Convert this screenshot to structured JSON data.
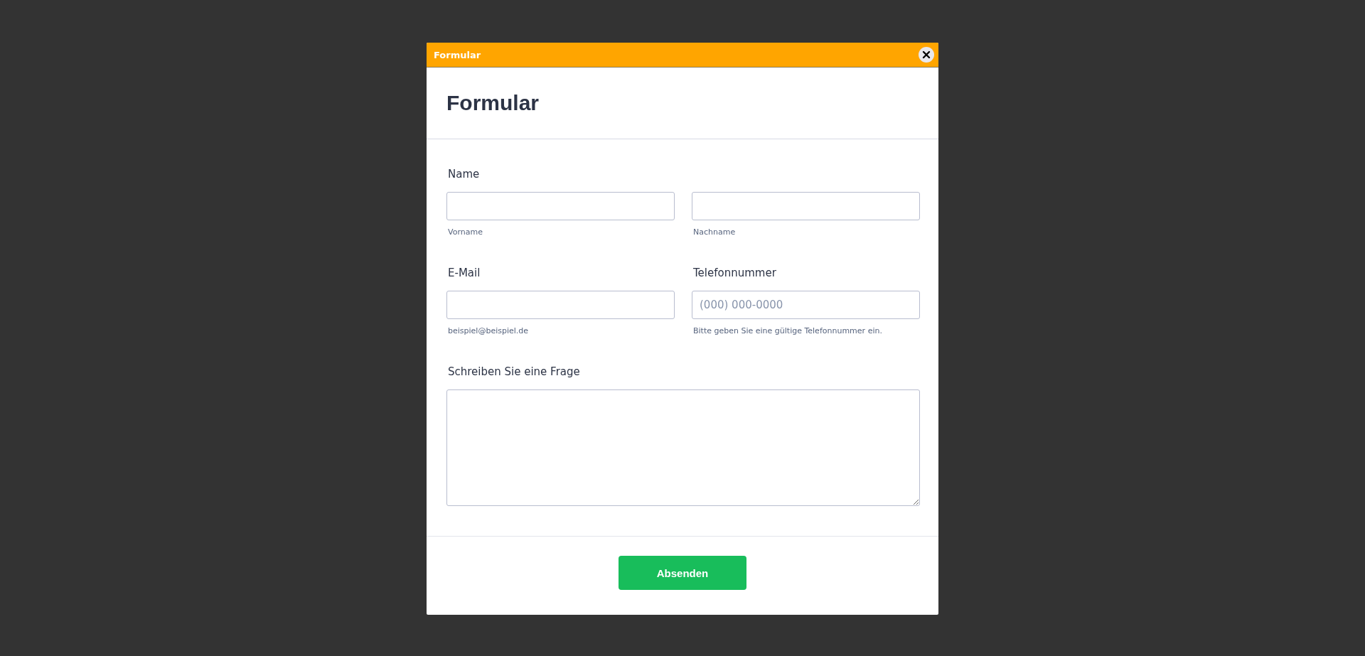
{
  "window": {
    "title": "Formular"
  },
  "heading": "Formular",
  "rows": [
    {
      "label": "Name",
      "fields": [
        {
          "kind": "text",
          "sublabel": "Vorname"
        },
        {
          "kind": "text",
          "sublabel": "Nachname"
        }
      ]
    },
    {
      "fields": [
        {
          "kind": "text",
          "label": "E-Mail",
          "sublabel": "beispiel@beispiel.de"
        },
        {
          "kind": "text",
          "label": "Telefonnummer",
          "placeholder": "(000) 000-0000",
          "sublabel": "Bitte geben Sie eine gültige Telefonnummer ein."
        }
      ]
    },
    {
      "fields": [
        {
          "kind": "textarea",
          "label": "Schreiben Sie eine Frage"
        }
      ]
    }
  ],
  "submit": "Absenden"
}
